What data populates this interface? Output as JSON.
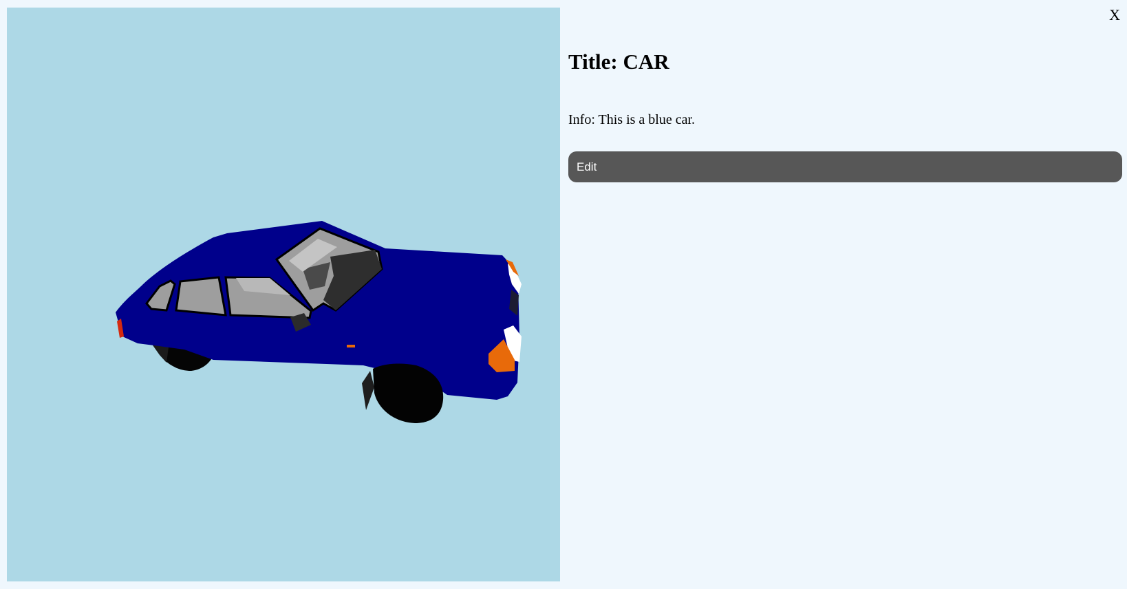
{
  "viewer": {
    "background_color": "#add8e6",
    "model_color": "#00008b",
    "model_subject": "blue hatchback car"
  },
  "close": {
    "label": "X"
  },
  "details": {
    "title": "Title: CAR",
    "info": "Info: This is a blue car.",
    "edit_label": "Edit"
  },
  "colors": {
    "page_background": "#eff7fd",
    "button_background": "#575757",
    "button_text": "#ffffff"
  }
}
